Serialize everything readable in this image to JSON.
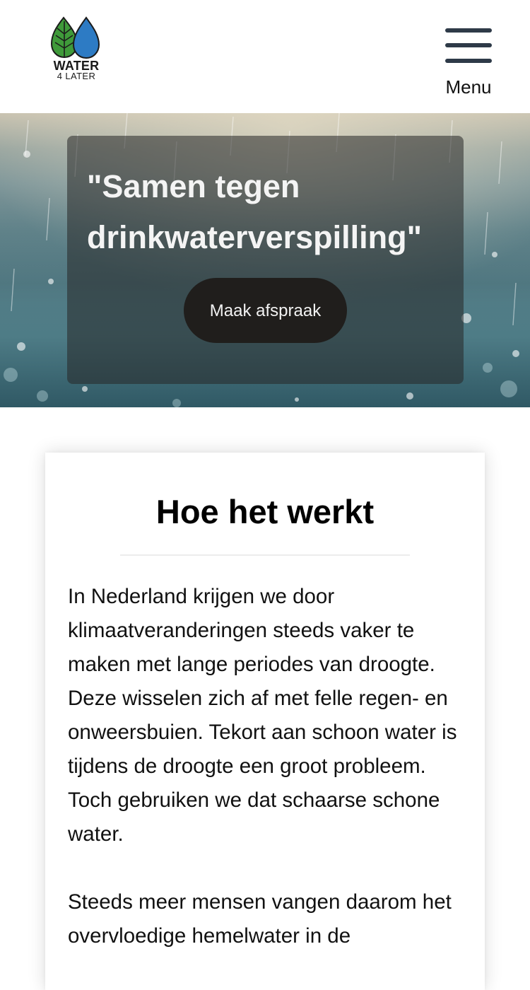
{
  "header": {
    "logo": {
      "line1": "WATER",
      "line2": "4 LATER",
      "icon": "leaf-and-waterdrop-icon",
      "leaf_color": "#3f9a3a",
      "drop_color": "#2d7bc4"
    },
    "menu": {
      "label": "Menu",
      "icon": "hamburger-icon",
      "color": "#2e3a48"
    }
  },
  "hero": {
    "title": "\"Samen tegen drinkwaterverspilling\"",
    "button_label": "Maak afspraak"
  },
  "section": {
    "title": "Hoe het werkt",
    "paragraphs": [
      "In Nederland krijgen we door klimaatveranderingen steeds vaker te maken met lange periodes van droogte. Deze wisselen zich af met felle regen- en onweersbuien. Tekort aan schoon water is tijdens de droogte een groot probleem. Toch gebruiken we dat schaarse schone water.",
      "Steeds meer mensen vangen daarom het overvloedige hemelwater in de"
    ]
  }
}
